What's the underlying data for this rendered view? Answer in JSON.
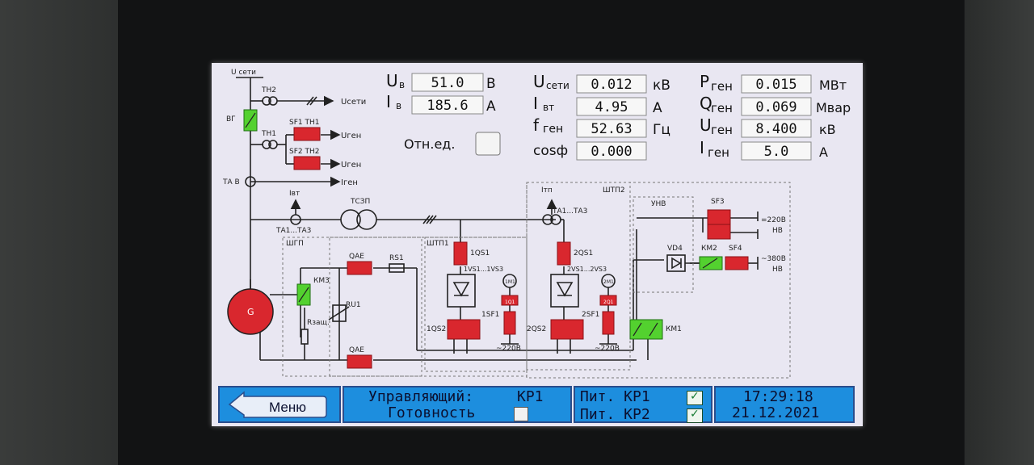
{
  "readings": {
    "uv": {
      "name": "U",
      "sub": "в",
      "value": "51.0",
      "unit": "В"
    },
    "iv": {
      "name": "I",
      "sub": "в",
      "value": "185.6",
      "unit": "А"
    },
    "useti": {
      "name": "U",
      "sub": "сети",
      "value": "0.012",
      "unit": "кВ"
    },
    "ivt": {
      "name": "I",
      "sub": "вт",
      "value": "4.95",
      "unit": "А"
    },
    "fgen": {
      "name": "f",
      "sub": "ген",
      "value": "52.63",
      "unit": "Гц"
    },
    "cosf": {
      "name": "cosф",
      "value": "0.000"
    },
    "pgen": {
      "name": "P",
      "sub": "ген",
      "value": "0.015",
      "unit": "МВт"
    },
    "qgen": {
      "name": "Q",
      "sub": "ген",
      "value": "0.069",
      "unit": "Мвар"
    },
    "ugen": {
      "name": "U",
      "sub": "ген",
      "value": "8.400",
      "unit": "кВ"
    },
    "igen": {
      "name": "I",
      "sub": "ген",
      "value": "5.0",
      "unit": "А"
    },
    "otn_label": "Отн.ед."
  },
  "diagram": {
    "u_seti": "U сети",
    "th2": "TH2",
    "th1": "TH1",
    "vg": "ВГ",
    "useti_arrow": "Uсети",
    "sf1_th1": "SF1 TH1",
    "sf2_th2": "SF2 TH2",
    "ugen1": "Uген",
    "ugen2": "Uген",
    "igen": "Iген",
    "tav": "ТА В",
    "ivt": "Iвт",
    "ta1ta3_left": "ТА1...ТА3",
    "tszp": "ТСЗП",
    "itp": "Iтп",
    "ta1ta3_right": "ТА1...ТА3",
    "shtp2": "ШТП2",
    "shgp": "ШГП",
    "shtp1": "ШТП1",
    "unv": "УНВ",
    "km3": "КМ3",
    "qae_top": "QAE",
    "qae_bottom": "QAE",
    "rs1": "RS1",
    "ru1": "RU1",
    "rzasch": "Rзащ.",
    "gen": "G",
    "qs1_1": "1QS1",
    "vs_1": "1VS1...1VS3",
    "qs2_1": "1QS2",
    "sf_1": "1SF1",
    "m_1": "1М1",
    "q_1": "1Q1",
    "v220_1": "~220В",
    "qs1_2": "2QS1",
    "vs_2": "2VS1...2VS3",
    "qs2_2": "2QS2",
    "sf_2": "2SF1",
    "m_2": "2М1",
    "q_2": "2Q1",
    "v220_2": "~220В",
    "km1": "КМ1",
    "sf3": "SF3",
    "vd4": "VD4",
    "km2": "КМ2",
    "sf4": "SF4",
    "dc220": "=220В",
    "nv1": "НВ",
    "ac380": "~380В",
    "nv2": "НВ"
  },
  "status": {
    "menu_label": "Меню",
    "control_label": "Управляющий:",
    "control_value": "КР1",
    "ready_label": "Готовность",
    "ready_checked": false,
    "pit_kr1_label": "Пит. КР1",
    "pit_kr1_checked": true,
    "pit_kr2_label": "Пит. КР2",
    "pit_kr2_checked": true,
    "time": "17:29:18",
    "date": "21.12.2021"
  },
  "colors": {
    "breaker_open": "#d9272e",
    "breaker_closed": "#53d12f",
    "status_bar": "#1d8ede",
    "line": "#222222"
  }
}
